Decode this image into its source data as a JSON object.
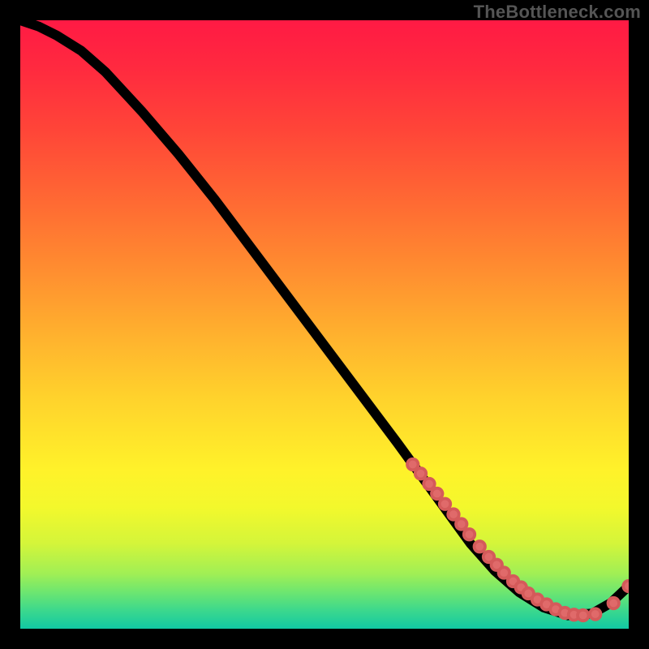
{
  "watermark": "TheBottleneck.com",
  "chart_data": {
    "type": "line",
    "title": "",
    "xlabel": "",
    "ylabel": "",
    "xlim": [
      0,
      100
    ],
    "ylim": [
      0,
      100
    ],
    "grid": false,
    "legend": false,
    "background_gradient": {
      "direction": "vertical",
      "stops": [
        {
          "pos": 0,
          "color": "#ff1a44"
        },
        {
          "pos": 30,
          "color": "#ff6a33"
        },
        {
          "pos": 62,
          "color": "#ffd22c"
        },
        {
          "pos": 80,
          "color": "#f3f82c"
        },
        {
          "pos": 97,
          "color": "#3cd88d"
        },
        {
          "pos": 100,
          "color": "#11c9a3"
        }
      ]
    },
    "series": [
      {
        "name": "curve",
        "kind": "line",
        "x": [
          0,
          3,
          6,
          10,
          14,
          20,
          26,
          32,
          38,
          44,
          50,
          56,
          62,
          66,
          70,
          74,
          78,
          82,
          86,
          90,
          94,
          97,
          100
        ],
        "y": [
          100,
          99,
          97.5,
          95,
          91.5,
          85,
          78,
          70.5,
          62.5,
          54.5,
          46.5,
          38.5,
          30.5,
          25,
          19.5,
          14,
          9.5,
          6,
          3.5,
          2.2,
          2.5,
          4.2,
          7
        ]
      },
      {
        "name": "markers",
        "kind": "scatter",
        "x": [
          64.5,
          65.8,
          67.2,
          68.5,
          69.8,
          71.2,
          72.5,
          73.8,
          75.5,
          77.0,
          78.3,
          79.5,
          81.0,
          82.3,
          83.5,
          85.0,
          86.5,
          88.0,
          89.5,
          91.0,
          92.5,
          94.5,
          97.5,
          100
        ],
        "y": [
          27.0,
          25.5,
          23.8,
          22.2,
          20.5,
          18.8,
          17.2,
          15.5,
          13.5,
          11.8,
          10.5,
          9.2,
          7.8,
          6.8,
          5.8,
          4.8,
          4.0,
          3.2,
          2.6,
          2.3,
          2.2,
          2.4,
          4.2,
          7.0
        ]
      }
    ]
  }
}
